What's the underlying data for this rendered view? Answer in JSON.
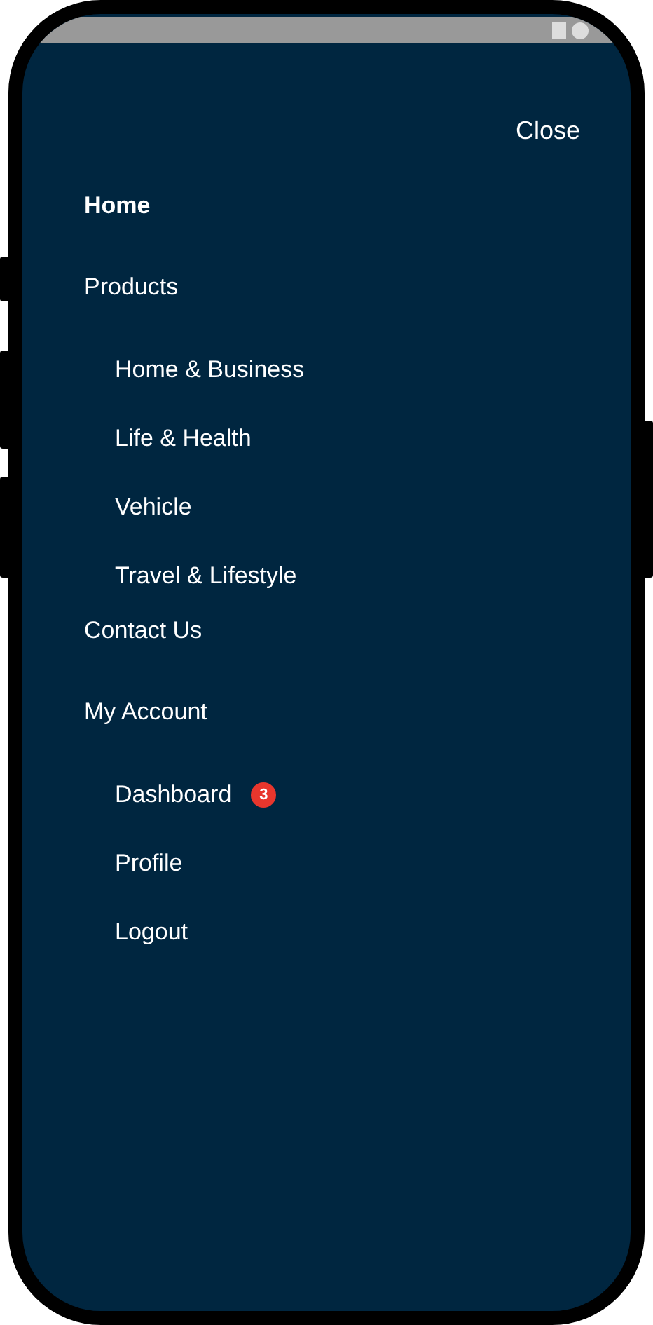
{
  "close": "Close",
  "menu": [
    {
      "label": "Home",
      "selected": true
    },
    {
      "label": "Products",
      "selected": false,
      "children": [
        {
          "label": "Home & Business"
        },
        {
          "label": "Life & Health"
        },
        {
          "label": "Vehicle"
        },
        {
          "label": "Travel & Lifestyle"
        }
      ]
    },
    {
      "label": "Contact Us",
      "selected": false
    },
    {
      "label": "My Account",
      "selected": false,
      "children": [
        {
          "label": "Dashboard",
          "badge": "3"
        },
        {
          "label": "Profile"
        },
        {
          "label": "Logout"
        }
      ]
    }
  ]
}
